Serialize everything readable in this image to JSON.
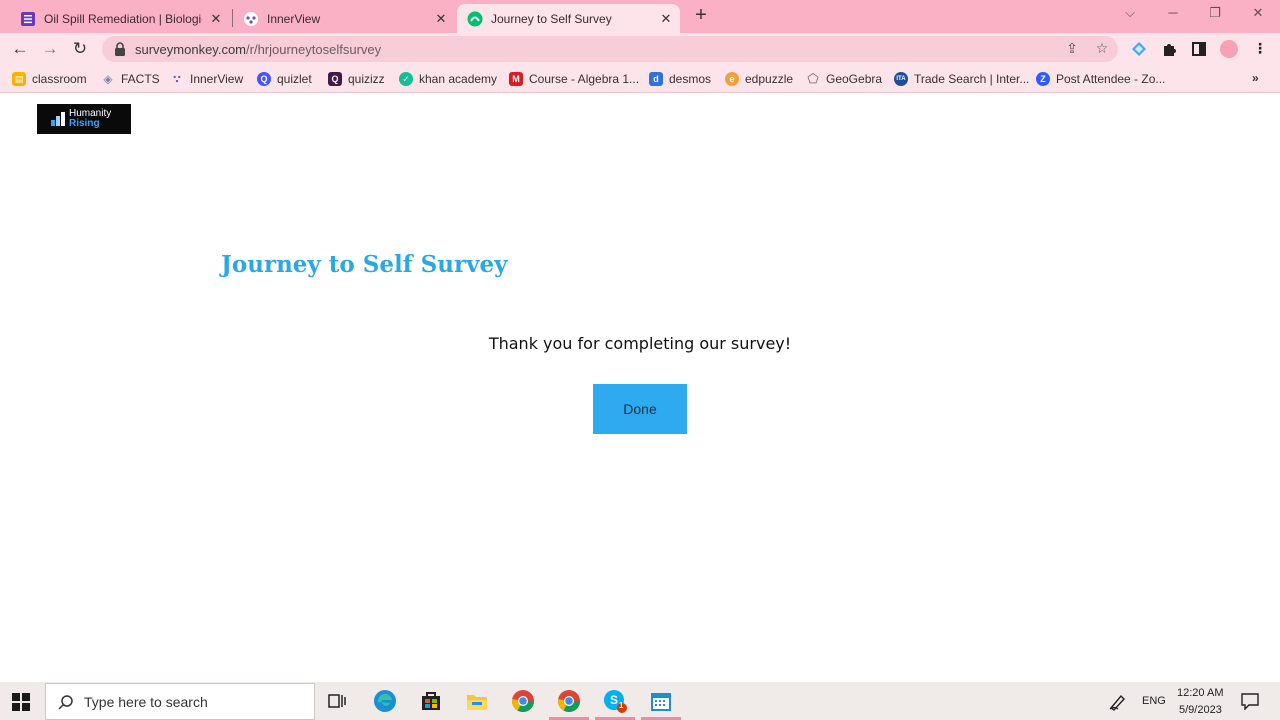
{
  "browser": {
    "tabs": [
      {
        "title": "Oil Spill Remediation | Biological",
        "icon": "forms-icon",
        "active": false
      },
      {
        "title": "InnerView",
        "icon": "innerview-icon",
        "active": false
      },
      {
        "title": "Journey to Self Survey",
        "icon": "surveymonkey-icon",
        "active": true
      }
    ],
    "url_host": "surveymonkey.com",
    "url_path": "/r/hrjourneytoselfsurvey",
    "bookmarks": [
      {
        "label": "classroom",
        "icon": "classroom-icon",
        "color": "#f4b400"
      },
      {
        "label": "FACTS",
        "icon": "facts-icon",
        "color": "#7a8aa0"
      },
      {
        "label": "InnerView",
        "icon": "innerview-icon",
        "color": "#5b5bd6"
      },
      {
        "label": "quizlet",
        "icon": "quizlet-icon",
        "color": "#4255ff"
      },
      {
        "label": "quizizz",
        "icon": "quizizz-icon",
        "color": "#46184c"
      },
      {
        "label": "khan academy",
        "icon": "khan-icon",
        "color": "#14bf96"
      },
      {
        "label": "Course - Algebra 1...",
        "icon": "mcgraw-icon",
        "color": "#d81e25"
      },
      {
        "label": "desmos",
        "icon": "desmos-icon",
        "color": "#2f72dc"
      },
      {
        "label": "edpuzzle",
        "icon": "edpuzzle-icon",
        "color": "#f2a13a"
      },
      {
        "label": "GeoGebra",
        "icon": "geogebra-icon",
        "color": "#666666"
      },
      {
        "label": "Trade Search | Inter...",
        "icon": "ita-icon",
        "color": "#1b4f9c"
      },
      {
        "label": "Post Attendee - Zo...",
        "icon": "zoom-icon",
        "color": "#2d5bff"
      }
    ]
  },
  "page": {
    "logo_line1": "Humanity",
    "logo_line2": "Rising",
    "title": "Journey to Self Survey",
    "message": "Thank you for completing our survey!",
    "done_label": "Done"
  },
  "taskbar": {
    "search_placeholder": "Type here to search",
    "language": "ENG",
    "time": "12:20 AM",
    "date": "5/9/2023",
    "skype_badge": "1"
  },
  "colors": {
    "accent_title": "#2ba7e4",
    "button": "#2eaaf0",
    "chrome_tabbar": "#fbb1c5",
    "chrome_toolbar": "#fde3ea"
  }
}
